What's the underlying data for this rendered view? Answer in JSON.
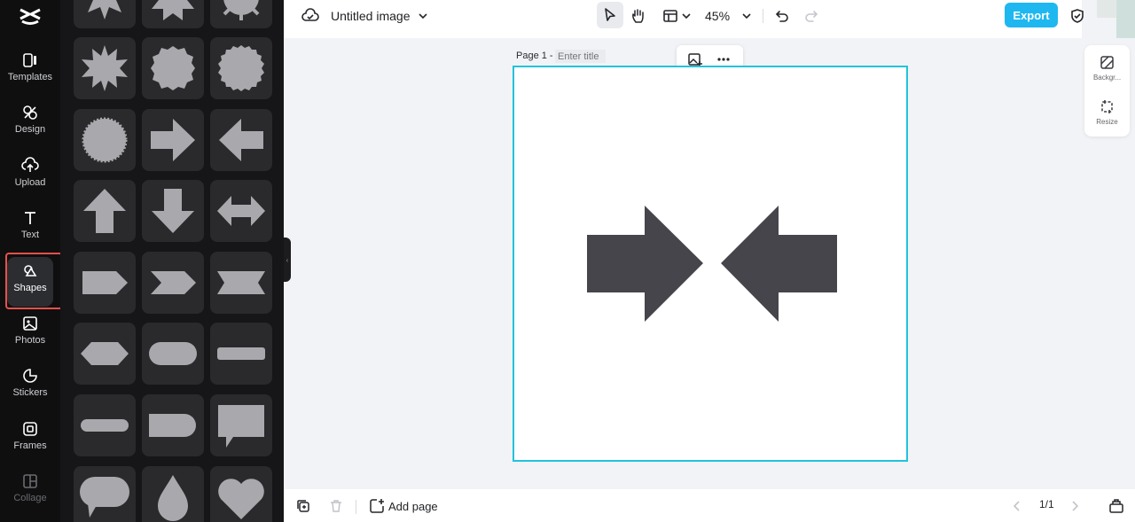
{
  "rail": {
    "items": [
      {
        "label": "Templates",
        "icon": "templates-icon"
      },
      {
        "label": "Design",
        "icon": "design-icon"
      },
      {
        "label": "Upload",
        "icon": "upload-icon"
      },
      {
        "label": "Text",
        "icon": "text-icon"
      },
      {
        "label": "Shapes",
        "icon": "shapes-icon",
        "active": true
      },
      {
        "label": "Photos",
        "icon": "photos-icon"
      },
      {
        "label": "Stickers",
        "icon": "stickers-icon"
      },
      {
        "label": "Frames",
        "icon": "frames-icon"
      },
      {
        "label": "Collage",
        "icon": "collage-icon"
      }
    ]
  },
  "panel": {
    "shapes": [
      "star-burst-shape",
      "star-seal-shape",
      "star-sun-shape",
      "star-spiky-shape",
      "star-badge-shape",
      "star-round-shape",
      "seal-circle-shape",
      "arrow-right-shape",
      "arrow-left-shape",
      "arrow-up-shape",
      "arrow-down-shape",
      "arrow-double-shape",
      "pentagon-tag-shape",
      "chevron-shape",
      "ribbon-shape",
      "hexagon-shape",
      "pill-shape",
      "bar-shape",
      "thin-pill-shape",
      "rounded-rect-shape",
      "speech-bubble-shape",
      "round-bubble-shape",
      "drop-shape",
      "heart-shape"
    ]
  },
  "topbar": {
    "title": "Untitled image",
    "zoom": "45%",
    "export_label": "Export"
  },
  "sidetools": {
    "background_label": "Backgr...",
    "resize_label": "Resize"
  },
  "canvas": {
    "page_label": "Page 1 -",
    "title_placeholder": "Enter title"
  },
  "bottombar": {
    "add_page_label": "Add page",
    "pager": "1/1"
  },
  "colors": {
    "accent": "#1fb7f0",
    "selection": "#22c3dc",
    "shape_fill": "#46454b",
    "highlight": "#e9504a"
  }
}
